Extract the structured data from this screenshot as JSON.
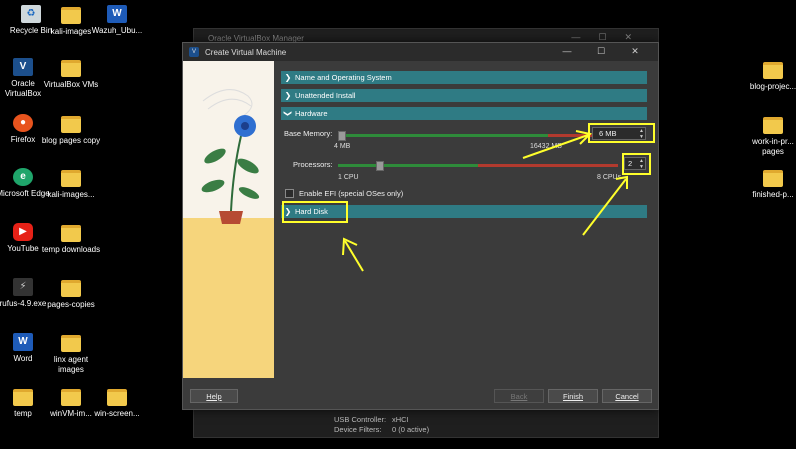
{
  "desktop": {
    "left_icons": [
      {
        "label": "Recycle Bin",
        "icon": "recycle-bin-icon"
      },
      {
        "label": "kali-images",
        "icon": "folder-icon"
      },
      {
        "label": "Wazuh_Ubu...",
        "icon": "word-doc-icon"
      },
      {
        "label": "Oracle VirtualBox",
        "icon": "virtualbox-icon"
      },
      {
        "label": "VirtualBox VMs",
        "icon": "folder-icon"
      },
      {
        "label": "Firefox",
        "icon": "firefox-icon"
      },
      {
        "label": "blog pages copy",
        "icon": "folder-icon"
      },
      {
        "label": "Microsoft Edge",
        "icon": "edge-icon"
      },
      {
        "label": "kali-images...",
        "icon": "folder-icon"
      },
      {
        "label": "YouTube",
        "icon": "youtube-icon"
      },
      {
        "label": "temp downloads",
        "icon": "folder-icon"
      },
      {
        "label": "rufus-4.9.exe",
        "icon": "usb-icon"
      },
      {
        "label": "pages-copies",
        "icon": "folder-icon"
      },
      {
        "label": "Word",
        "icon": "word-icon"
      },
      {
        "label": "linx agent images",
        "icon": "folder-icon"
      },
      {
        "label": "temp",
        "icon": "folder-icon"
      },
      {
        "label": "winVM-im...",
        "icon": "folder-icon"
      },
      {
        "label": "win-screen...",
        "icon": "folder-icon"
      }
    ],
    "right_icons": [
      {
        "label": "blog-projec...",
        "icon": "folder-icon"
      },
      {
        "label": "work-in-pr... pages",
        "icon": "folder-icon"
      },
      {
        "label": "finished-p...",
        "icon": "folder-icon"
      }
    ]
  },
  "manager_window": {
    "title": "Oracle VirtualBox Manager",
    "usb_controller_label": "USB Controller:",
    "usb_controller_value": "xHCI",
    "device_filters_label": "Device Filters:",
    "device_filters_value": "0 (0 active)"
  },
  "dialog": {
    "title": "Create Virtual Machine",
    "sections": {
      "name_os": "Name and Operating System",
      "unattended": "Unattended Install",
      "hardware": "Hardware",
      "hard_disk": "Hard Disk"
    },
    "base_memory": {
      "label": "Base Memory:",
      "value": "6 MB",
      "min_label": "4 MB",
      "max_label": "16432 MB"
    },
    "processors": {
      "label": "Processors:",
      "value": "2",
      "min_label": "1 CPU",
      "max_label": "8 CPUs"
    },
    "efi_label": "Enable EFI (special OSes only)",
    "buttons": {
      "help": "Help",
      "back": "Back",
      "finish": "Finish",
      "cancel": "Cancel"
    }
  },
  "colors": {
    "section_bar": "#2f7b84",
    "highlight": "#ffff2b"
  }
}
